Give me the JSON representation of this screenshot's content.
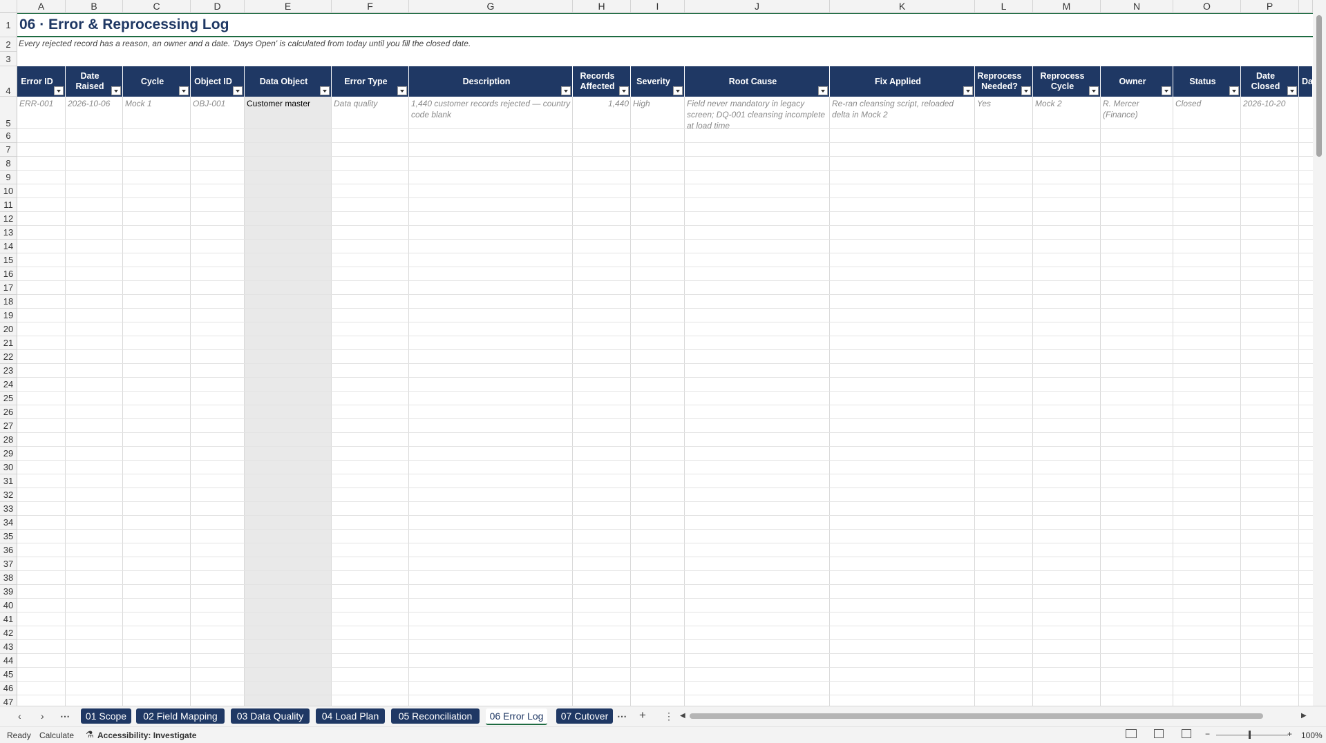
{
  "columns": [
    "A",
    "B",
    "C",
    "D",
    "E",
    "F",
    "G",
    "H",
    "I",
    "J",
    "K",
    "L",
    "M",
    "N",
    "O",
    "P"
  ],
  "rows": [
    "1",
    "2",
    "3",
    "4",
    "5",
    "6",
    "7",
    "8",
    "9",
    "10",
    "11",
    "12",
    "13",
    "14",
    "15",
    "16",
    "17",
    "18",
    "19",
    "20",
    "21",
    "22",
    "23",
    "24",
    "25",
    "26",
    "27",
    "28",
    "29",
    "30",
    "31",
    "32",
    "33",
    "34",
    "35",
    "36",
    "37",
    "38",
    "39",
    "40",
    "41",
    "42",
    "43",
    "44",
    "45",
    "46",
    "47"
  ],
  "sheet": {
    "title": "06 · Error & Reprocessing Log",
    "subtitle": "Every rejected record has a reason, an owner and a date. 'Days Open' is calculated from today until you fill the closed date."
  },
  "headers": [
    "Error ID",
    "Date Raised",
    "Cycle",
    "Object ID",
    "Data Object",
    "Error Type",
    "Description",
    "Records Affected",
    "Severity",
    "Root Cause",
    "Fix Applied",
    "Reprocess Needed?",
    "Reprocess Cycle",
    "Owner",
    "Status",
    "Date Closed",
    "Da"
  ],
  "row5": {
    "error_id": "ERR-001",
    "date_raised": "2026-10-06",
    "cycle": "Mock 1",
    "object_id": "OBJ-001",
    "data_object": "Customer master",
    "error_type": "Data quality",
    "description": "1,440 customer records rejected — country code blank",
    "records_affected": "1,440",
    "severity": "High",
    "root_cause": "Field never mandatory in legacy screen; DQ-001 cleansing incomplete at load time",
    "fix_applied": "Re-ran cleansing script, reloaded delta in Mock 2",
    "reprocess_needed": "Yes",
    "reprocess_cycle": "Mock 2",
    "owner": "R. Mercer (Finance)",
    "status": "Closed",
    "date_closed": "2026-10-20"
  },
  "tabs": [
    "01 Scope",
    "02 Field Mapping",
    "03 Data Quality",
    "04 Load Plan",
    "05 Reconciliation",
    "06 Error Log",
    "07 Cutover"
  ],
  "active_tab": "06 Error Log",
  "tab_controls": {
    "more": "⋯",
    "add": "+",
    "menu": "⋮"
  },
  "status": {
    "ready": "Ready",
    "calculate": "Calculate",
    "accessibility": "Accessibility: Investigate",
    "zoom": "100%"
  }
}
